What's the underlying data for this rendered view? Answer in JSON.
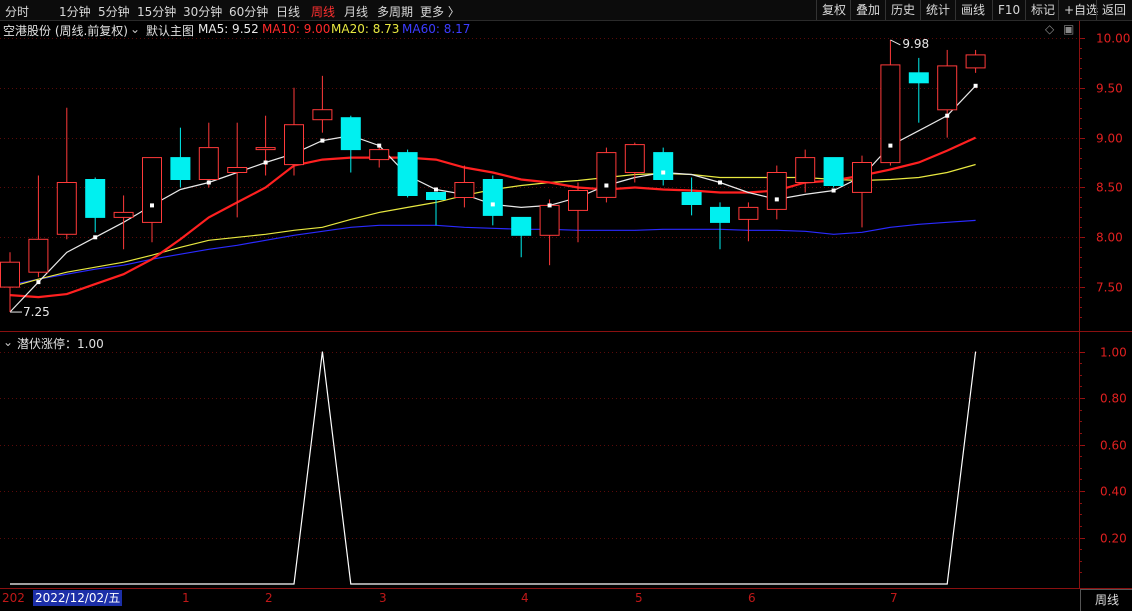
{
  "toolbar": {
    "left_items": [
      "分时",
      "1分钟",
      "5分钟",
      "15分钟",
      "30分钟",
      "60分钟",
      "日线",
      "周线",
      "月线",
      "多周期",
      "更多 〉"
    ],
    "active": "周线",
    "right_items": [
      "复权",
      "叠加",
      "历史",
      "统计",
      "画线",
      "F10",
      "标记",
      "+自选",
      "返回"
    ]
  },
  "main_panel": {
    "title": "空港股份 (周线.前复权)",
    "template_label": "默认主图",
    "ma_legends": [
      {
        "text": "MA5: 9.52",
        "color": "#e8e8e8"
      },
      {
        "text": "MA10: 9.00",
        "color": "#ff2a2a"
      },
      {
        "text": "MA20: 8.73",
        "color": "#e8e840"
      },
      {
        "text": "MA60: 8.17",
        "color": "#2a2aff"
      }
    ],
    "high_label": "9.98",
    "low_label": "7.25"
  },
  "sub_panel": {
    "title": "潜伏涨停：1.00"
  },
  "x_axis": {
    "year_prefix": "202",
    "selected_date": "2022/12/02/五",
    "month_labels": [
      "1",
      "2",
      "3",
      "4",
      "5",
      "6",
      "7"
    ]
  },
  "period_label": "周线",
  "colors": {
    "up": "#ff3a3a",
    "down": "#00f0f0",
    "ma5": "#e8e8e8",
    "ma10": "#ff2020",
    "ma20": "#e8e840",
    "ma60": "#2a2aff",
    "axis_text": "#e02020"
  },
  "chart_data": [
    {
      "type": "candlestick",
      "title": "空港股份 (周线.前复权)",
      "ylim": [
        7.1,
        10.1
      ],
      "y_ticks": [
        7.5,
        8.0,
        8.5,
        9.0,
        9.5,
        10.0
      ],
      "candles": [
        {
          "o": 7.5,
          "h": 7.85,
          "l": 7.25,
          "c": 7.75
        },
        {
          "o": 7.65,
          "h": 8.62,
          "l": 7.6,
          "c": 7.98
        },
        {
          "o": 8.03,
          "h": 9.3,
          "l": 7.98,
          "c": 8.55
        },
        {
          "o": 8.58,
          "h": 8.6,
          "l": 8.05,
          "c": 8.2
        },
        {
          "o": 8.2,
          "h": 8.42,
          "l": 7.88,
          "c": 8.25
        },
        {
          "o": 8.15,
          "h": 8.8,
          "l": 7.95,
          "c": 8.8
        },
        {
          "o": 8.8,
          "h": 9.1,
          "l": 8.5,
          "c": 8.58
        },
        {
          "o": 8.58,
          "h": 9.15,
          "l": 8.5,
          "c": 8.9
        },
        {
          "o": 8.65,
          "h": 9.15,
          "l": 8.2,
          "c": 8.7
        },
        {
          "o": 8.88,
          "h": 9.22,
          "l": 8.62,
          "c": 8.9
        },
        {
          "o": 8.73,
          "h": 9.5,
          "l": 8.62,
          "c": 9.13
        },
        {
          "o": 9.18,
          "h": 9.62,
          "l": 9.05,
          "c": 9.28
        },
        {
          "o": 9.2,
          "h": 9.22,
          "l": 8.65,
          "c": 8.88
        },
        {
          "o": 8.78,
          "h": 8.92,
          "l": 8.7,
          "c": 8.88
        },
        {
          "o": 8.85,
          "h": 8.88,
          "l": 8.4,
          "c": 8.42
        },
        {
          "o": 8.45,
          "h": 8.45,
          "l": 8.12,
          "c": 8.38
        },
        {
          "o": 8.4,
          "h": 8.72,
          "l": 8.3,
          "c": 8.55
        },
        {
          "o": 8.58,
          "h": 8.62,
          "l": 8.12,
          "c": 8.22
        },
        {
          "o": 8.2,
          "h": 8.2,
          "l": 7.8,
          "c": 8.02
        },
        {
          "o": 8.02,
          "h": 8.38,
          "l": 7.72,
          "c": 8.32
        },
        {
          "o": 8.27,
          "h": 8.55,
          "l": 7.95,
          "c": 8.47
        },
        {
          "o": 8.4,
          "h": 8.9,
          "l": 8.35,
          "c": 8.85
        },
        {
          "o": 8.65,
          "h": 8.95,
          "l": 8.55,
          "c": 8.93
        },
        {
          "o": 8.85,
          "h": 8.9,
          "l": 8.52,
          "c": 8.58
        },
        {
          "o": 8.45,
          "h": 8.6,
          "l": 8.22,
          "c": 8.33
        },
        {
          "o": 8.3,
          "h": 8.35,
          "l": 7.88,
          "c": 8.15
        },
        {
          "o": 8.18,
          "h": 8.35,
          "l": 7.96,
          "c": 8.3
        },
        {
          "o": 8.28,
          "h": 8.72,
          "l": 8.18,
          "c": 8.65
        },
        {
          "o": 8.55,
          "h": 8.88,
          "l": 8.45,
          "c": 8.8
        },
        {
          "o": 8.8,
          "h": 8.8,
          "l": 8.5,
          "c": 8.52
        },
        {
          "o": 8.45,
          "h": 8.82,
          "l": 8.1,
          "c": 8.75
        },
        {
          "o": 8.75,
          "h": 9.98,
          "l": 8.72,
          "c": 9.73
        },
        {
          "o": 9.65,
          "h": 9.8,
          "l": 9.15,
          "c": 9.55
        },
        {
          "o": 9.28,
          "h": 9.88,
          "l": 9.0,
          "c": 9.72
        },
        {
          "o": 9.7,
          "h": 9.88,
          "l": 9.65,
          "c": 9.83
        }
      ],
      "series": [
        {
          "name": "MA5",
          "values": [
            7.25,
            7.55,
            7.85,
            8.0,
            8.15,
            8.32,
            8.48,
            8.55,
            8.65,
            8.75,
            8.84,
            8.97,
            9.02,
            8.92,
            8.62,
            8.48,
            8.43,
            8.33,
            8.3,
            8.32,
            8.4,
            8.52,
            8.6,
            8.65,
            8.63,
            8.55,
            8.45,
            8.38,
            8.43,
            8.47,
            8.61,
            8.92,
            9.07,
            9.22,
            9.52
          ]
        },
        {
          "name": "MA10",
          "values": [
            7.42,
            7.4,
            7.43,
            7.53,
            7.63,
            7.78,
            7.98,
            8.2,
            8.35,
            8.5,
            8.72,
            8.78,
            8.8,
            8.8,
            8.8,
            8.78,
            8.7,
            8.65,
            8.58,
            8.55,
            8.5,
            8.48,
            8.5,
            8.48,
            8.47,
            8.45,
            8.45,
            8.47,
            8.55,
            8.57,
            8.62,
            8.68,
            8.75,
            8.87,
            9.0
          ]
        },
        {
          "name": "MA20",
          "values": [
            7.5,
            7.58,
            7.65,
            7.7,
            7.75,
            7.82,
            7.9,
            7.97,
            8.0,
            8.03,
            8.07,
            8.1,
            8.18,
            8.25,
            8.3,
            8.35,
            8.42,
            8.48,
            8.52,
            8.55,
            8.57,
            8.6,
            8.63,
            8.64,
            8.63,
            8.6,
            8.6,
            8.6,
            8.6,
            8.58,
            8.57,
            8.58,
            8.6,
            8.65,
            8.73
          ]
        },
        {
          "name": "MA60",
          "values": [
            7.52,
            7.58,
            7.63,
            7.68,
            7.72,
            7.78,
            7.83,
            7.88,
            7.92,
            7.97,
            8.02,
            8.06,
            8.1,
            8.12,
            8.12,
            8.12,
            8.1,
            8.09,
            8.08,
            8.08,
            8.07,
            8.07,
            8.07,
            8.08,
            8.08,
            8.08,
            8.07,
            8.07,
            8.06,
            8.03,
            8.05,
            8.1,
            8.13,
            8.15,
            8.17
          ]
        }
      ],
      "annotations": [
        {
          "text": "9.98",
          "at": "high"
        },
        {
          "text": "7.25",
          "at": "low"
        }
      ]
    },
    {
      "type": "line",
      "title": "潜伏涨停：1.00",
      "ylim": [
        0,
        1.05
      ],
      "y_ticks": [
        0.2,
        0.4,
        0.6,
        0.8,
        1.0
      ],
      "series": [
        {
          "name": "潜伏涨停",
          "values": [
            0,
            0,
            0,
            0,
            0,
            0,
            0,
            0,
            0,
            0,
            0,
            1,
            0,
            0,
            0,
            0,
            0,
            0,
            0,
            0,
            0,
            0,
            0,
            0,
            0,
            0,
            0,
            0,
            0,
            0,
            0,
            0,
            0,
            0,
            1
          ]
        }
      ]
    }
  ]
}
